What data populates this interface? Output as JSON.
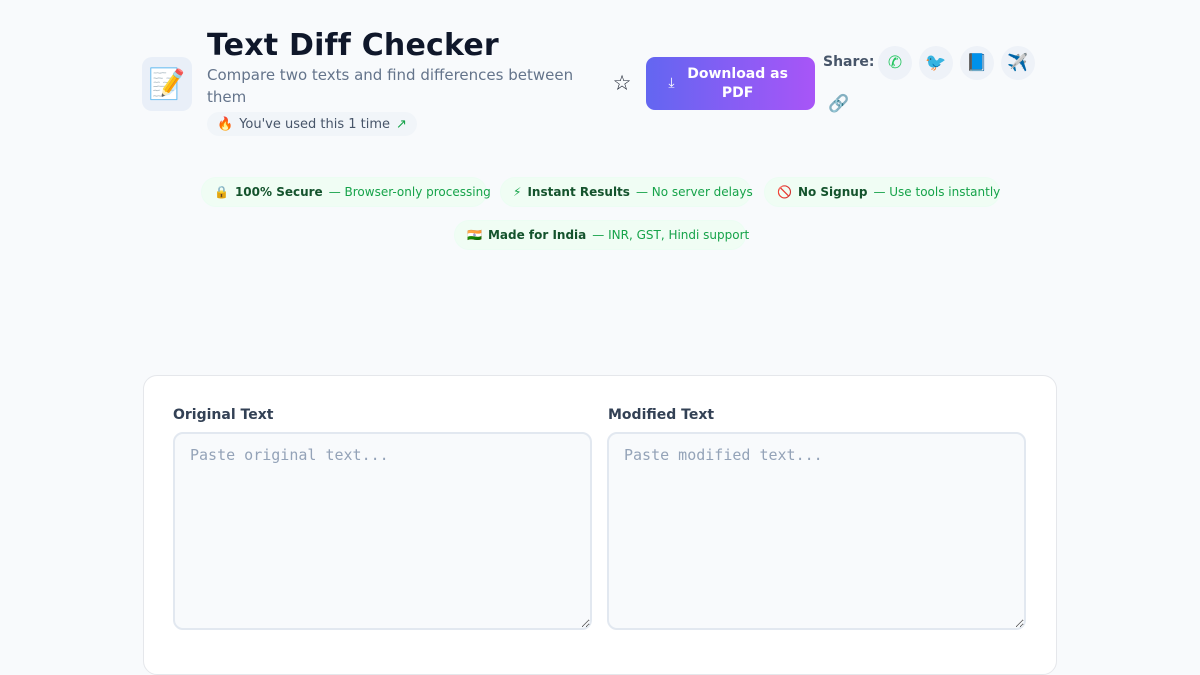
{
  "header": {
    "app_icon": "memo-icon",
    "app_icon_glyph": "📝",
    "title": "Text Diff Checker",
    "subtitle": "Compare two texts and find differences between them",
    "usage": {
      "emoji": "🔥",
      "text": "You've used this 1 time",
      "trend_glyph": "↗"
    },
    "favorite_glyph": "☆",
    "download": {
      "icon_glyph": "⤓",
      "label": "Download as PDF",
      "gradient": [
        "#6366f1",
        "#a855f7"
      ]
    },
    "share": {
      "label": "Share:",
      "buttons": [
        {
          "name": "whatsapp-icon",
          "glyph": "✆"
        },
        {
          "name": "twitter-icon",
          "glyph": "🐦"
        },
        {
          "name": "facebook-icon",
          "glyph": "📘"
        },
        {
          "name": "telegram-icon",
          "glyph": "✈️"
        },
        {
          "name": "link-icon",
          "glyph": "🔗"
        }
      ]
    }
  },
  "badges": [
    {
      "icon": "🔒",
      "title": "100% Secure",
      "desc": "— Browser-only processing"
    },
    {
      "icon": "⚡",
      "title": "Instant Results",
      "desc": "— No server delays"
    },
    {
      "icon": "🚫",
      "title": "No Signup",
      "desc": "— Use tools instantly"
    },
    {
      "icon": "🇮🇳",
      "title": "Made for India",
      "desc": "— INR, GST, Hindi support"
    }
  ],
  "editor": {
    "original": {
      "label": "Original Text",
      "placeholder": "Paste original text...",
      "value": ""
    },
    "modified": {
      "label": "Modified Text",
      "placeholder": "Paste modified text...",
      "value": ""
    }
  },
  "colors": {
    "accent_green": "#16a34a",
    "background": "#f8fafc",
    "title": "#0f172a"
  }
}
